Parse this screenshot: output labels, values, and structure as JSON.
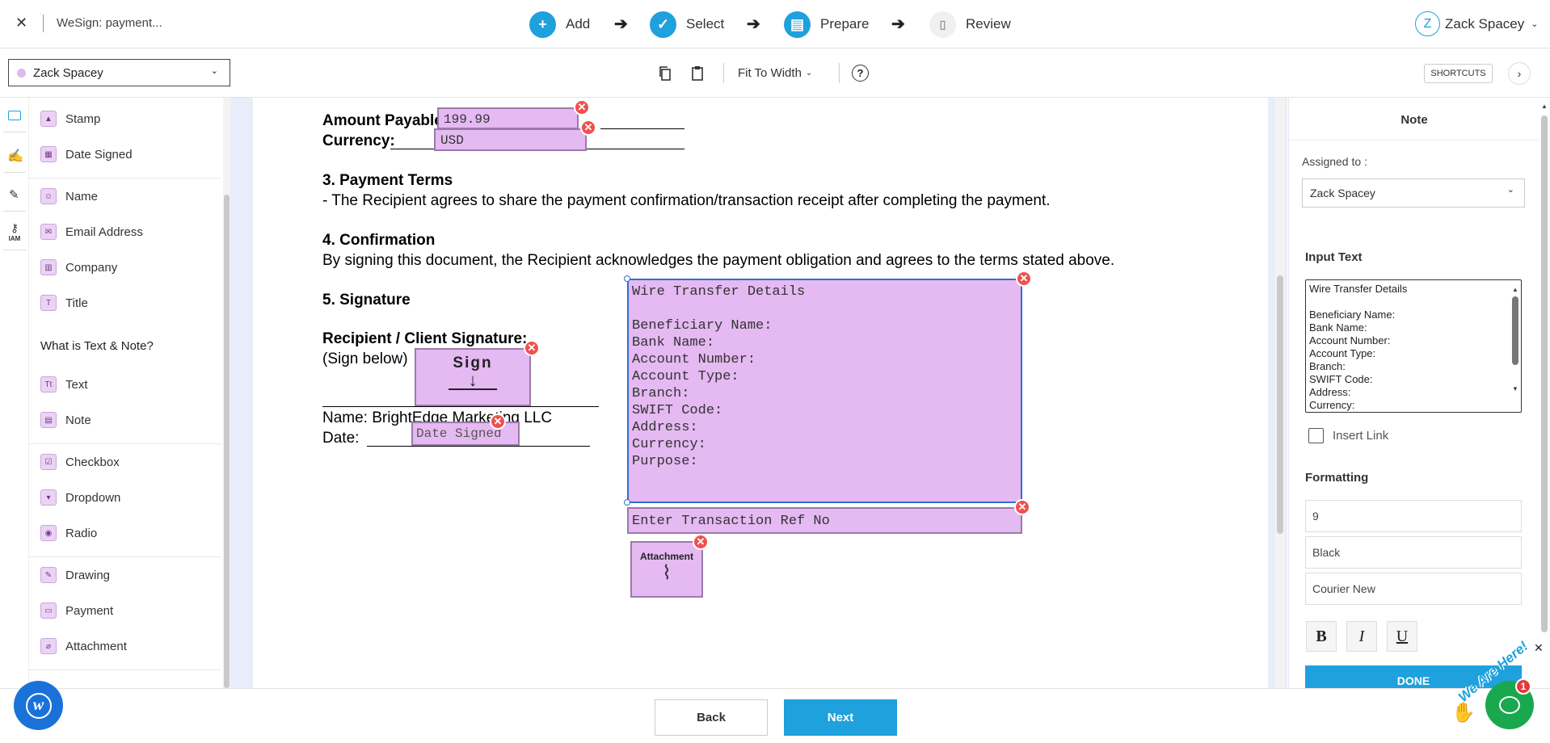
{
  "app": {
    "doc_title": "WeSign: payment...",
    "close_glyph": "✕"
  },
  "steps": [
    {
      "label": "Add",
      "icon": "plus-circle-icon"
    },
    {
      "label": "Select",
      "icon": "check-circle-icon"
    },
    {
      "label": "Prepare",
      "icon": "document-icon"
    },
    {
      "label": "Review",
      "icon": "review-document-icon"
    }
  ],
  "user": {
    "initial": "Z",
    "name": "Zack Spacey"
  },
  "toolbar": {
    "recipient": "Zack Spacey",
    "fit_label": "Fit To Width",
    "help_glyph": "?",
    "shortcuts_label": "SHORTCUTS"
  },
  "left_fields": {
    "group1": [
      {
        "label": "Stamp",
        "icon": "stamp-icon"
      },
      {
        "label": "Date Signed",
        "icon": "calendar-icon"
      }
    ],
    "group2": [
      {
        "label": "Name",
        "icon": "person-icon"
      },
      {
        "label": "Email Address",
        "icon": "envelope-icon"
      },
      {
        "label": "Company",
        "icon": "building-icon"
      },
      {
        "label": "Title",
        "icon": "title-icon"
      }
    ],
    "help_text": "What is Text & Note?",
    "group3": [
      {
        "label": "Text",
        "icon": "text-icon"
      },
      {
        "label": "Note",
        "icon": "note-icon"
      }
    ],
    "group4": [
      {
        "label": "Checkbox",
        "icon": "checkbox-icon"
      },
      {
        "label": "Dropdown",
        "icon": "dropdown-icon"
      },
      {
        "label": "Radio",
        "icon": "radio-icon"
      }
    ],
    "group5": [
      {
        "label": "Drawing",
        "icon": "drawing-icon"
      },
      {
        "label": "Payment",
        "icon": "payment-icon"
      },
      {
        "label": "Attachment",
        "icon": "attachment-icon"
      }
    ]
  },
  "rail": {
    "iam_label": "IAM"
  },
  "document": {
    "amount_label": "Amount Payable:",
    "amount_value": "199.99",
    "currency_label": "Currency:",
    "currency_value": "USD",
    "terms_heading": "3. Payment Terms",
    "terms_text": "- The Recipient agrees to share the payment confirmation/transaction receipt after completing the payment.",
    "confirm_heading": "4. Confirmation",
    "confirm_text": "By signing this document, the Recipient acknowledges the payment obligation and agrees to the terms stated above.",
    "sig_heading": "5. Signature",
    "recipient_heading": "Recipient / Client Signature:",
    "sign_below": "(Sign below)",
    "sign_label": "Sign",
    "name_line": "Name: BrightEdge Marketing LLC",
    "date_line": "Date:",
    "date_signed_label": "Date Signed",
    "note_lines": [
      "Wire Transfer Details",
      "",
      "Beneficiary Name:",
      "Bank Name:",
      "Account Number:",
      "Account Type:",
      "Branch:",
      "SWIFT Code:",
      "Address:",
      "Currency:",
      "Purpose:"
    ],
    "ref_placeholder": "Enter Transaction Ref No",
    "attachment_label": "Attachment"
  },
  "right_panel": {
    "title": "Note",
    "assigned_label": "Assigned to :",
    "assigned_value": "Zack Spacey",
    "input_text_label": "Input Text",
    "input_lines": [
      "Wire Transfer Details",
      "",
      "Beneficiary Name:",
      "Bank Name:",
      "Account Number:",
      "Account Type:",
      "Branch:",
      "SWIFT Code:",
      "Address:",
      "Currency:"
    ],
    "insert_link_label": "Insert Link",
    "formatting_label": "Formatting",
    "font_size": "9",
    "color": "Black",
    "font": "Courier New",
    "bold_label": "B",
    "italic_label": "I",
    "underline_label": "U",
    "done_label": "DONE"
  },
  "chat": {
    "badge": "1",
    "banner": "We Are Here!"
  },
  "footer": {
    "back_label": "Back",
    "next_label": "Next"
  },
  "colors": {
    "accent": "#1ea1dd",
    "field": "#e5b9f2",
    "delete": "#f05050",
    "chat": "#1aa84f"
  }
}
